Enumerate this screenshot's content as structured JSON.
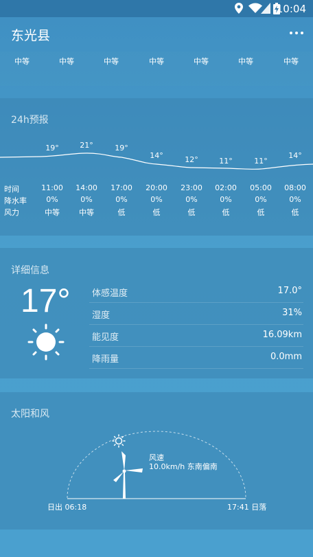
{
  "status_bar": {
    "time": "10:04"
  },
  "app_bar": {
    "city": "东光县"
  },
  "top_wind_row": [
    "中等",
    "中等",
    "中等",
    "中等",
    "中等",
    "中等",
    "中等"
  ],
  "forecast_24h": {
    "title": "24h预报",
    "temps": [
      "19°",
      "21°",
      "19°",
      "14°",
      "12°",
      "11°",
      "11°",
      "14°"
    ],
    "row_labels": {
      "time": "时间",
      "precip": "降水率",
      "wind": "风力"
    },
    "times": [
      "11:00",
      "14:00",
      "17:00",
      "20:00",
      "23:00",
      "02:00",
      "05:00",
      "08:00"
    ],
    "precip": [
      "0%",
      "0%",
      "0%",
      "0%",
      "0%",
      "0%",
      "0%",
      "0%"
    ],
    "wind": [
      "中等",
      "中等",
      "低",
      "低",
      "低",
      "低",
      "低",
      "低"
    ]
  },
  "details": {
    "title": "详细信息",
    "current_temp": "17°",
    "weather_icon": "sun-icon",
    "rows": [
      {
        "label": "体感温度",
        "value": "17.0°"
      },
      {
        "label": "湿度",
        "value": "31%"
      },
      {
        "label": "能见度",
        "value": "16.09km"
      },
      {
        "label": "降雨量",
        "value": "0.0mm"
      }
    ]
  },
  "sun_wind": {
    "title": "太阳和风",
    "wind_label": "风速",
    "wind_value": "10.0km/h 东南偏南",
    "sunrise": "日出 06:18",
    "sunset": "17:41 日落"
  }
}
